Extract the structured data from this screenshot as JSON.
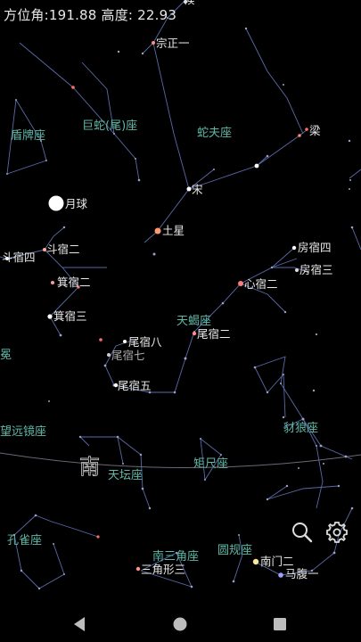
{
  "status": {
    "azimuth_label": "方位角:",
    "azimuth_value": "191.88",
    "altitude_label": "高度:",
    "altitude_value": "22.93"
  },
  "direction": {
    "label": "南"
  },
  "colors": {
    "constellation_label": "#5fb8a8",
    "star_label": "#e8e8e8",
    "line": "#5a6aa8",
    "horizon": "#6a6a7a",
    "red_star": "#ff6a6a",
    "blue_star": "#8a8aff",
    "moon": "#ffffff"
  },
  "constellations": [
    {
      "id": "dunpai",
      "label": "盾牌座"
    },
    {
      "id": "jushe",
      "label": "巨蛇(尾)座"
    },
    {
      "id": "shefu",
      "label": "蛇夫座"
    },
    {
      "id": "tianxie",
      "label": "天蝎座"
    },
    {
      "id": "chailang",
      "label": "豺狼座"
    },
    {
      "id": "wangyuanjing",
      "label": "望远镜座"
    },
    {
      "id": "tiantan",
      "label": "天坛座"
    },
    {
      "id": "juchi",
      "label": "矩尺座"
    },
    {
      "id": "kongque",
      "label": "孔雀座"
    },
    {
      "id": "nansanjiao",
      "label": "南三角座"
    },
    {
      "id": "yuangui",
      "label": "圆规座"
    },
    {
      "id": "xie",
      "label": "冕"
    }
  ],
  "stars": [
    {
      "id": "hou",
      "label": "候"
    },
    {
      "id": "zongzhengyi",
      "label": "宗正一"
    },
    {
      "id": "liang",
      "label": "梁"
    },
    {
      "id": "song",
      "label": "宋"
    },
    {
      "id": "tuxing",
      "label": "土星"
    },
    {
      "id": "yueqiu",
      "label": "月球"
    },
    {
      "id": "douxiuer",
      "label": "斗宿二"
    },
    {
      "id": "douxiusi",
      "label": "斗宿四"
    },
    {
      "id": "jixiuer",
      "label": "箕宿二"
    },
    {
      "id": "jixiusan",
      "label": "箕宿三"
    },
    {
      "id": "fangxiusi",
      "label": "房宿四"
    },
    {
      "id": "fangxiusan",
      "label": "房宿三"
    },
    {
      "id": "xinxiuer",
      "label": "心宿二"
    },
    {
      "id": "weixiuer",
      "label": "尾宿二"
    },
    {
      "id": "weixiuba",
      "label": "尾宿八"
    },
    {
      "id": "weixiuqi",
      "label": "尾宿七"
    },
    {
      "id": "weixiuwu",
      "label": "尾宿五"
    },
    {
      "id": "nanmener",
      "label": "南门二"
    },
    {
      "id": "mafuyi",
      "label": "马腹一"
    },
    {
      "id": "sanjiaoxingsan",
      "label": "三角形三"
    }
  ],
  "toolbar": {
    "search_icon": "search-icon",
    "settings_icon": "gear-icon"
  },
  "navigation": {
    "back_icon": "back-triangle-icon",
    "home_icon": "home-circle-icon",
    "recents_icon": "recents-square-icon"
  }
}
